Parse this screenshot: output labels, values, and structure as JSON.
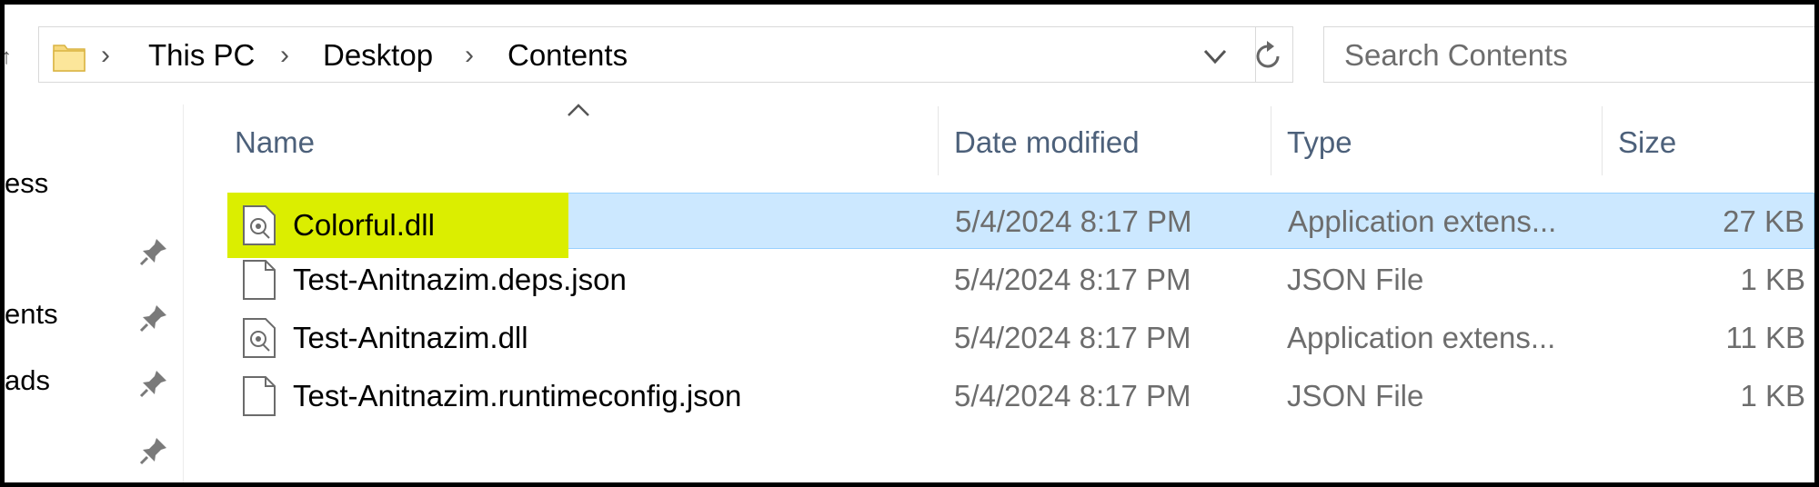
{
  "address_bar": {
    "breadcrumbs": [
      "This PC",
      "Desktop",
      "Contents"
    ],
    "folder_icon": "folder-icon"
  },
  "search": {
    "placeholder": "Search Contents",
    "value": ""
  },
  "nav_pane": {
    "items": [
      {
        "label": "ess",
        "pinned": false
      },
      {
        "label": "",
        "pinned": true
      },
      {
        "label": "ents",
        "pinned": true
      },
      {
        "label": "ads",
        "pinned": true
      },
      {
        "label": "",
        "pinned": true
      }
    ]
  },
  "columns": {
    "name": "Name",
    "date": "Date modified",
    "type": "Type",
    "size": "Size",
    "sorted_by": "Name"
  },
  "files": [
    {
      "name": "Colorful.dll",
      "date": "5/4/2024 8:17 PM",
      "type": "Application extens...",
      "size": "27 KB",
      "icon": "dll-file-icon",
      "selected": true,
      "highlighted": true
    },
    {
      "name": "Test-Anitnazim.deps.json",
      "date": "5/4/2024 8:17 PM",
      "type": "JSON File",
      "size": "1 KB",
      "icon": "json-file-icon",
      "selected": false,
      "highlighted": false
    },
    {
      "name": "Test-Anitnazim.dll",
      "date": "5/4/2024 8:17 PM",
      "type": "Application extens...",
      "size": "11 KB",
      "icon": "dll-file-icon",
      "selected": false,
      "highlighted": false
    },
    {
      "name": "Test-Anitnazim.runtimeconfig.json",
      "date": "5/4/2024 8:17 PM",
      "type": "JSON File",
      "size": "1 KB",
      "icon": "json-file-icon",
      "selected": false,
      "highlighted": false
    }
  ],
  "colors": {
    "selection": "#cce8ff",
    "selection_border": "#99d1ff",
    "highlight": "#dbee00",
    "header_text": "#4c607a"
  }
}
